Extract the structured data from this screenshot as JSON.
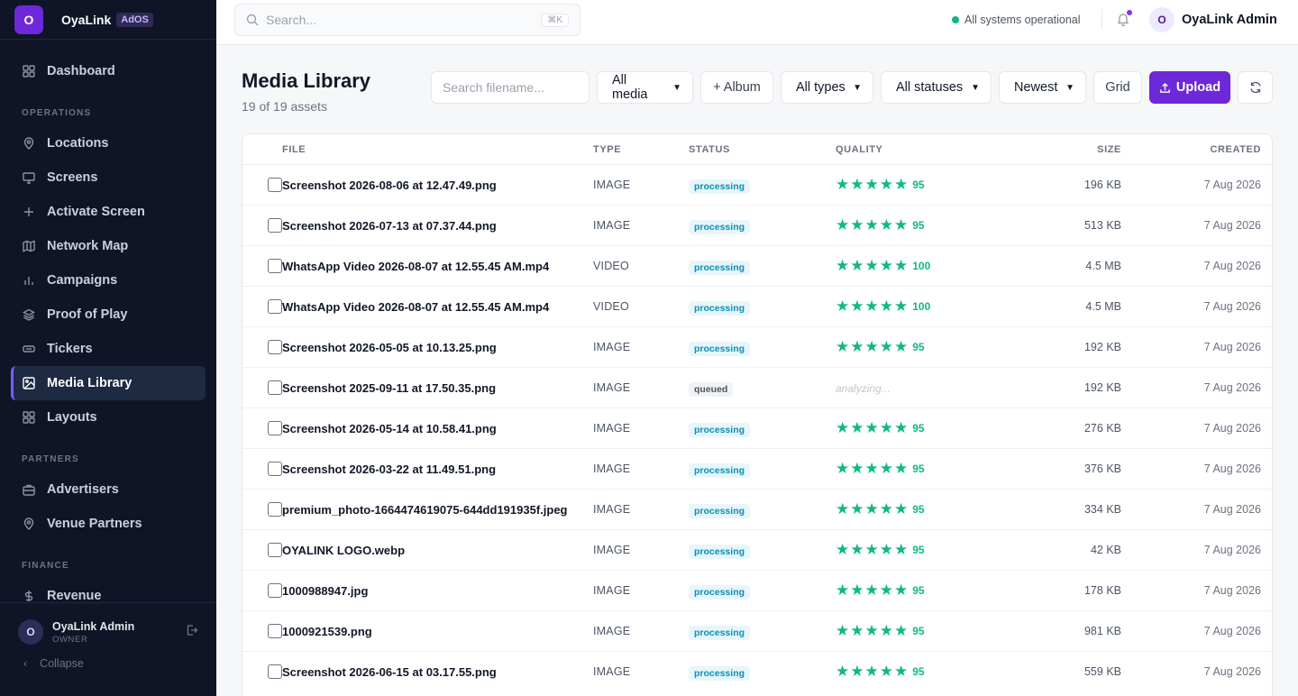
{
  "app": {
    "logo_letter": "O",
    "name": "OyaLink",
    "badge": "AdOS"
  },
  "sidebar": {
    "top_item": {
      "label": "Dashboard",
      "icon": "grid-icon"
    },
    "sections": [
      {
        "title": "OPERATIONS",
        "items": [
          {
            "label": "Locations",
            "icon": "pin-icon"
          },
          {
            "label": "Screens",
            "icon": "monitor-icon"
          },
          {
            "label": "Activate Screen",
            "icon": "plus-icon"
          },
          {
            "label": "Network Map",
            "icon": "map-icon"
          },
          {
            "label": "Campaigns",
            "icon": "bar-chart-icon"
          },
          {
            "label": "Proof of Play",
            "icon": "layers-icon"
          },
          {
            "label": "Tickers",
            "icon": "ticker-icon"
          },
          {
            "label": "Media Library",
            "icon": "image-icon",
            "active": true
          },
          {
            "label": "Layouts",
            "icon": "layout-icon"
          }
        ]
      },
      {
        "title": "PARTNERS",
        "items": [
          {
            "label": "Advertisers",
            "icon": "briefcase-icon"
          },
          {
            "label": "Venue Partners",
            "icon": "pin-icon"
          }
        ]
      },
      {
        "title": "FINANCE",
        "items": [
          {
            "label": "Revenue",
            "icon": "dollar-icon"
          }
        ]
      }
    ],
    "footer": {
      "avatar": "O",
      "name": "OyaLink Admin",
      "role": "OWNER",
      "collapse": "Collapse"
    }
  },
  "topbar": {
    "search_placeholder": "Search...",
    "shortcut": "⌘K",
    "status_text": "All systems operational",
    "status_color": "#10b981",
    "user_avatar": "O",
    "user_name": "OyaLink Admin"
  },
  "page": {
    "title": "Media Library",
    "subtitle": "19 of 19 assets",
    "filename_placeholder": "Search filename...",
    "filter_media": "All media",
    "album_button": "+ Album",
    "filter_types": "All types",
    "filter_statuses": "All statuses",
    "sort": "Newest",
    "view_toggle": "Grid",
    "upload_button": "Upload",
    "accent": "#6d28d9"
  },
  "table": {
    "headers": {
      "file": "FILE",
      "type": "TYPE",
      "status": "STATUS",
      "quality": "QUALITY",
      "size": "SIZE",
      "created": "CREATED"
    },
    "rows": [
      {
        "file": "Screenshot 2026-08-06 at 12.47.49.png",
        "type": "IMAGE",
        "status": "processing",
        "quality": "95",
        "stars": 5,
        "size": "196 KB",
        "created": "7 Aug 2026"
      },
      {
        "file": "Screenshot 2026-07-13 at 07.37.44.png",
        "type": "IMAGE",
        "status": "processing",
        "quality": "95",
        "stars": 5,
        "size": "513 KB",
        "created": "7 Aug 2026"
      },
      {
        "file": "WhatsApp Video 2026-08-07 at 12.55.45 AM.mp4",
        "type": "VIDEO",
        "status": "processing",
        "quality": "100",
        "stars": 5,
        "size": "4.5 MB",
        "created": "7 Aug 2026"
      },
      {
        "file": "WhatsApp Video 2026-08-07 at 12.55.45 AM.mp4",
        "type": "VIDEO",
        "status": "processing",
        "quality": "100",
        "stars": 5,
        "size": "4.5 MB",
        "created": "7 Aug 2026"
      },
      {
        "file": "Screenshot 2026-05-05 at 10.13.25.png",
        "type": "IMAGE",
        "status": "processing",
        "quality": "95",
        "stars": 5,
        "size": "192 KB",
        "created": "7 Aug 2026"
      },
      {
        "file": "Screenshot 2025-09-11 at 17.50.35.png",
        "type": "IMAGE",
        "status": "queued",
        "quality": "analyzing...",
        "stars": 0,
        "size": "192 KB",
        "created": "7 Aug 2026"
      },
      {
        "file": "Screenshot 2026-05-14 at 10.58.41.png",
        "type": "IMAGE",
        "status": "processing",
        "quality": "95",
        "stars": 5,
        "size": "276 KB",
        "created": "7 Aug 2026"
      },
      {
        "file": "Screenshot 2026-03-22 at 11.49.51.png",
        "type": "IMAGE",
        "status": "processing",
        "quality": "95",
        "stars": 5,
        "size": "376 KB",
        "created": "7 Aug 2026"
      },
      {
        "file": "premium_photo-1664474619075-644dd191935f.jpeg",
        "type": "IMAGE",
        "status": "processing",
        "quality": "95",
        "stars": 5,
        "size": "334 KB",
        "created": "7 Aug 2026"
      },
      {
        "file": "OYALINK LOGO.webp",
        "type": "IMAGE",
        "status": "processing",
        "quality": "95",
        "stars": 5,
        "size": "42 KB",
        "created": "7 Aug 2026"
      },
      {
        "file": "1000988947.jpg",
        "type": "IMAGE",
        "status": "processing",
        "quality": "95",
        "stars": 5,
        "size": "178 KB",
        "created": "7 Aug 2026"
      },
      {
        "file": "1000921539.png",
        "type": "IMAGE",
        "status": "processing",
        "quality": "95",
        "stars": 5,
        "size": "981 KB",
        "created": "7 Aug 2026"
      },
      {
        "file": "Screenshot 2026-06-15 at 03.17.55.png",
        "type": "IMAGE",
        "status": "processing",
        "quality": "95",
        "stars": 5,
        "size": "559 KB",
        "created": "7 Aug 2026"
      }
    ]
  }
}
